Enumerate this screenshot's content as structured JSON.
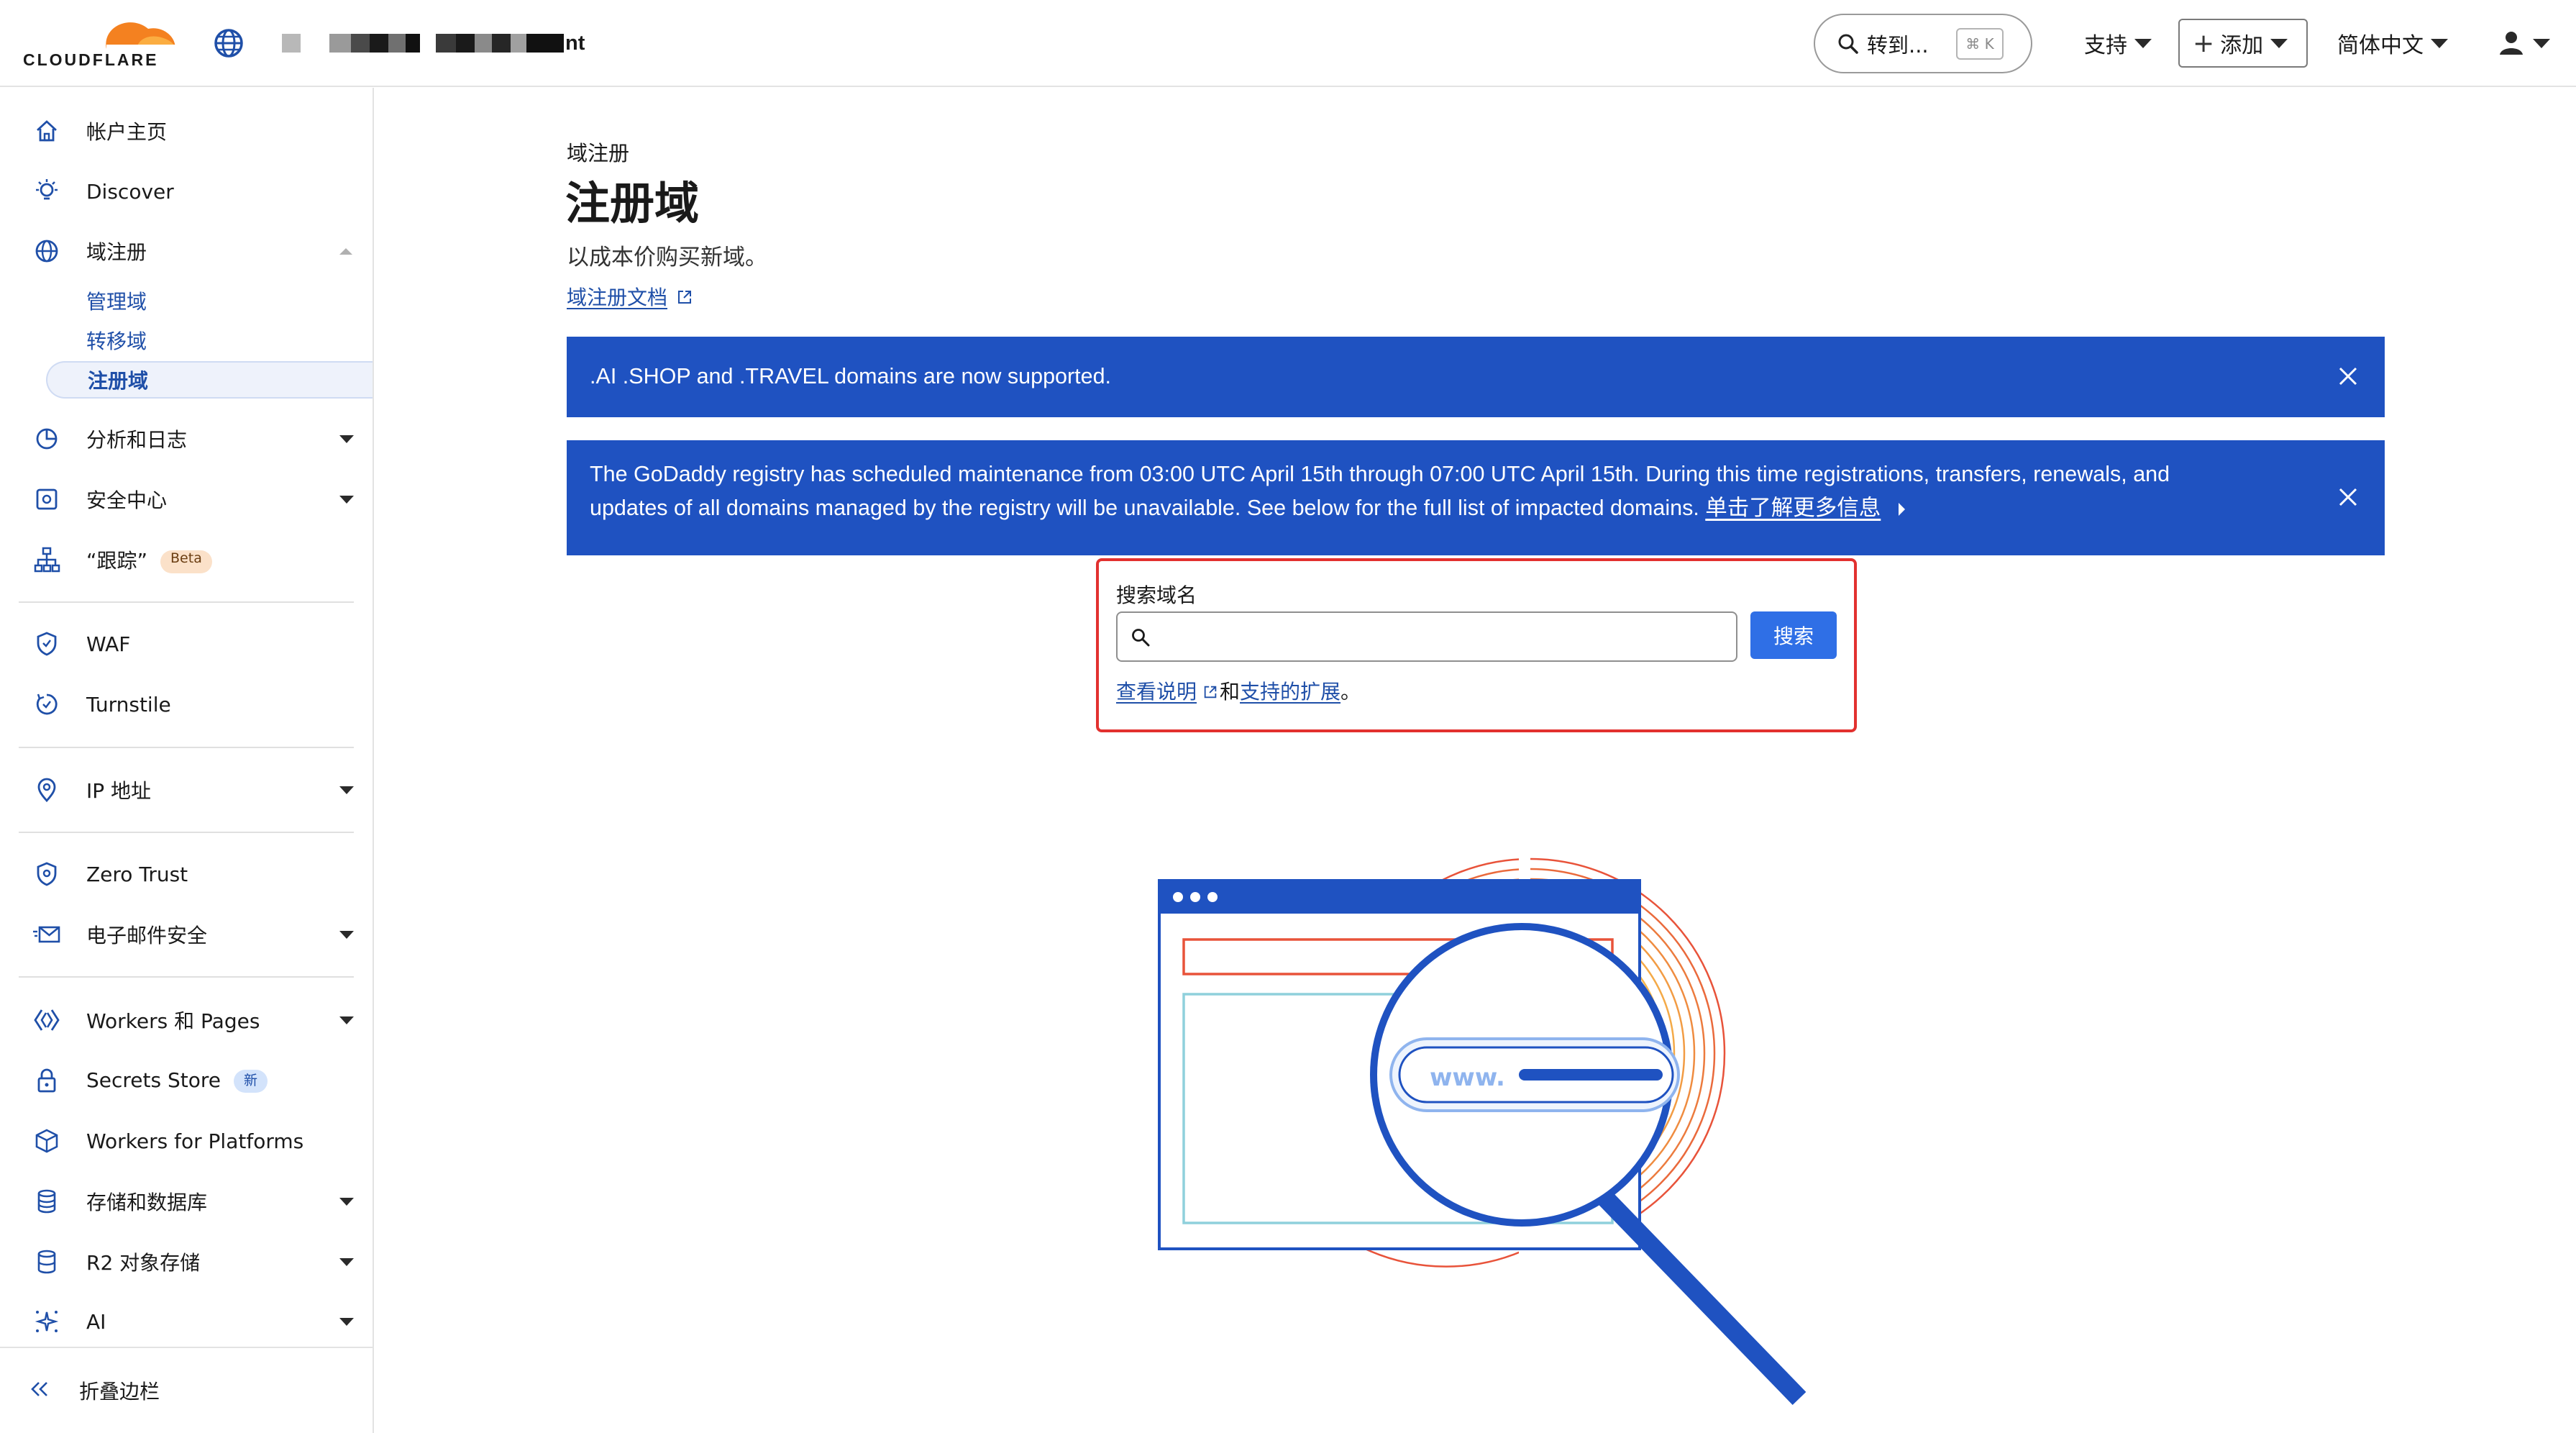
{
  "header": {
    "logo_text": "CLOUDFLARE",
    "account_suffix": "nt",
    "goto_label": "转到...",
    "goto_shortcut": "⌘ K",
    "support_label": "支持",
    "add_label": "添加",
    "language_label": "简体中文"
  },
  "sidebar": {
    "items": [
      {
        "label": "帐户主页"
      },
      {
        "label": "Discover"
      },
      {
        "label": "域注册"
      },
      {
        "label": "分析和日志"
      },
      {
        "label": "安全中心"
      },
      {
        "label": "“跟踪”",
        "badge": "Beta"
      },
      {
        "label": "WAF"
      },
      {
        "label": "Turnstile"
      },
      {
        "label": "IP 地址"
      },
      {
        "label": "Zero Trust"
      },
      {
        "label": "电子邮件安全"
      },
      {
        "label": "Workers 和 Pages"
      },
      {
        "label": "Secrets Store",
        "badge": "新"
      },
      {
        "label": "Workers for Platforms"
      },
      {
        "label": "存储和数据库"
      },
      {
        "label": "R2 对象存储"
      },
      {
        "label": "AI"
      }
    ],
    "sub_items": [
      {
        "label": "管理域"
      },
      {
        "label": "转移域"
      },
      {
        "label": "注册域",
        "active": true
      }
    ],
    "collapse_label": "折叠边栏"
  },
  "main": {
    "eyebrow": "域注册",
    "title": "注册域",
    "description": "以成本价购买新域。",
    "docs_link": "域注册文档",
    "banners": [
      {
        "text": ".AI .SHOP and .TRAVEL domains are now supported."
      },
      {
        "text_line1": "The GoDaddy registry has scheduled maintenance from 03:00 UTC April 15th through 07:00 UTC April 15th. During this time registrations, transfers, renewals, and",
        "text_line2": "updates of all domains managed by the registry will be unavailable. See below for the full list of impacted domains.",
        "link": "单击了解更多信息"
      }
    ],
    "search": {
      "label": "搜索域名",
      "value": "",
      "placeholder": "",
      "button": "搜索",
      "help_link1": "查看说明",
      "help_and": "和",
      "help_link2": "支持的扩展",
      "help_end": "。"
    },
    "illustration": {
      "url_text": "www."
    }
  },
  "colors": {
    "brand_orange": "#f48120",
    "banner_blue": "#1f52c1",
    "button_blue": "#2f6fe6",
    "link_blue": "#1f4fa8",
    "highlight_red": "#e2312f"
  }
}
